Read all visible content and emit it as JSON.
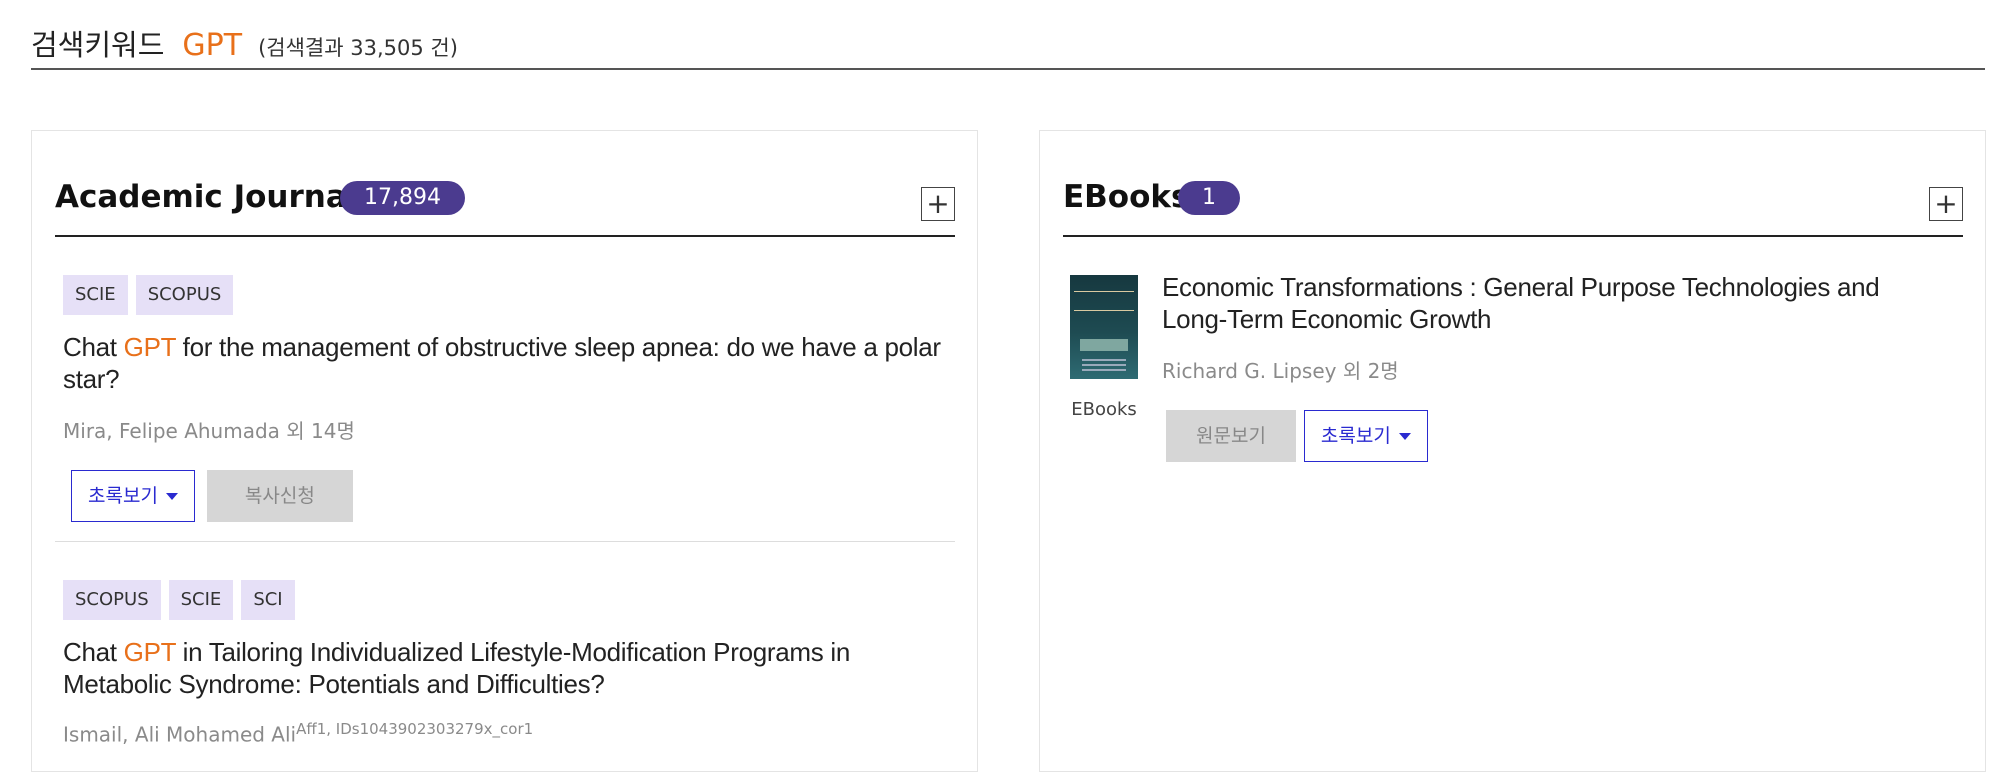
{
  "search": {
    "label": "검색키워드",
    "keyword": "GPT",
    "result_count": "(검색결과 33,505 건)"
  },
  "journals": {
    "title": "Academic Journals",
    "count": "17,894",
    "expand_label": "+",
    "articles": [
      {
        "tags": [
          "SCIE",
          "SCOPUS"
        ],
        "title_pre": "Chat ",
        "title_highlight": "GPT",
        "title_post": " for the management of obstructive sleep apnea: do we have a polar star?",
        "authors": "Mira, Felipe Ahumada 외 14명",
        "abstract_button": "초록보기",
        "copy_button": "복사신청"
      },
      {
        "tags": [
          "SCOPUS",
          "SCIE",
          "SCI"
        ],
        "title_pre": "Chat ",
        "title_highlight": "GPT",
        "title_post": " in Tailoring Individualized Lifestyle-Modification Programs in Metabolic Syndrome: Potentials and Difficulties?",
        "authors": "Ismail, Ali Mohamed Ali",
        "authors_sup": "Aff1, IDs1043902303279x_cor1"
      }
    ]
  },
  "ebooks": {
    "title": "EBooks",
    "count": "1",
    "expand_label": "+",
    "items": [
      {
        "title": "Economic Transformations : General Purpose Technologies and Long-Term Economic Growth",
        "authors": "Richard G. Lipsey 외 2명",
        "caption": "EBooks",
        "fulltext_button": "원문보기",
        "abstract_button": "초록보기"
      }
    ]
  },
  "colors": {
    "accent": "#e8701a",
    "pill": "#4b3b8f",
    "tag_bg": "#e6e0f7",
    "button_blue": "#2a2ad0"
  }
}
